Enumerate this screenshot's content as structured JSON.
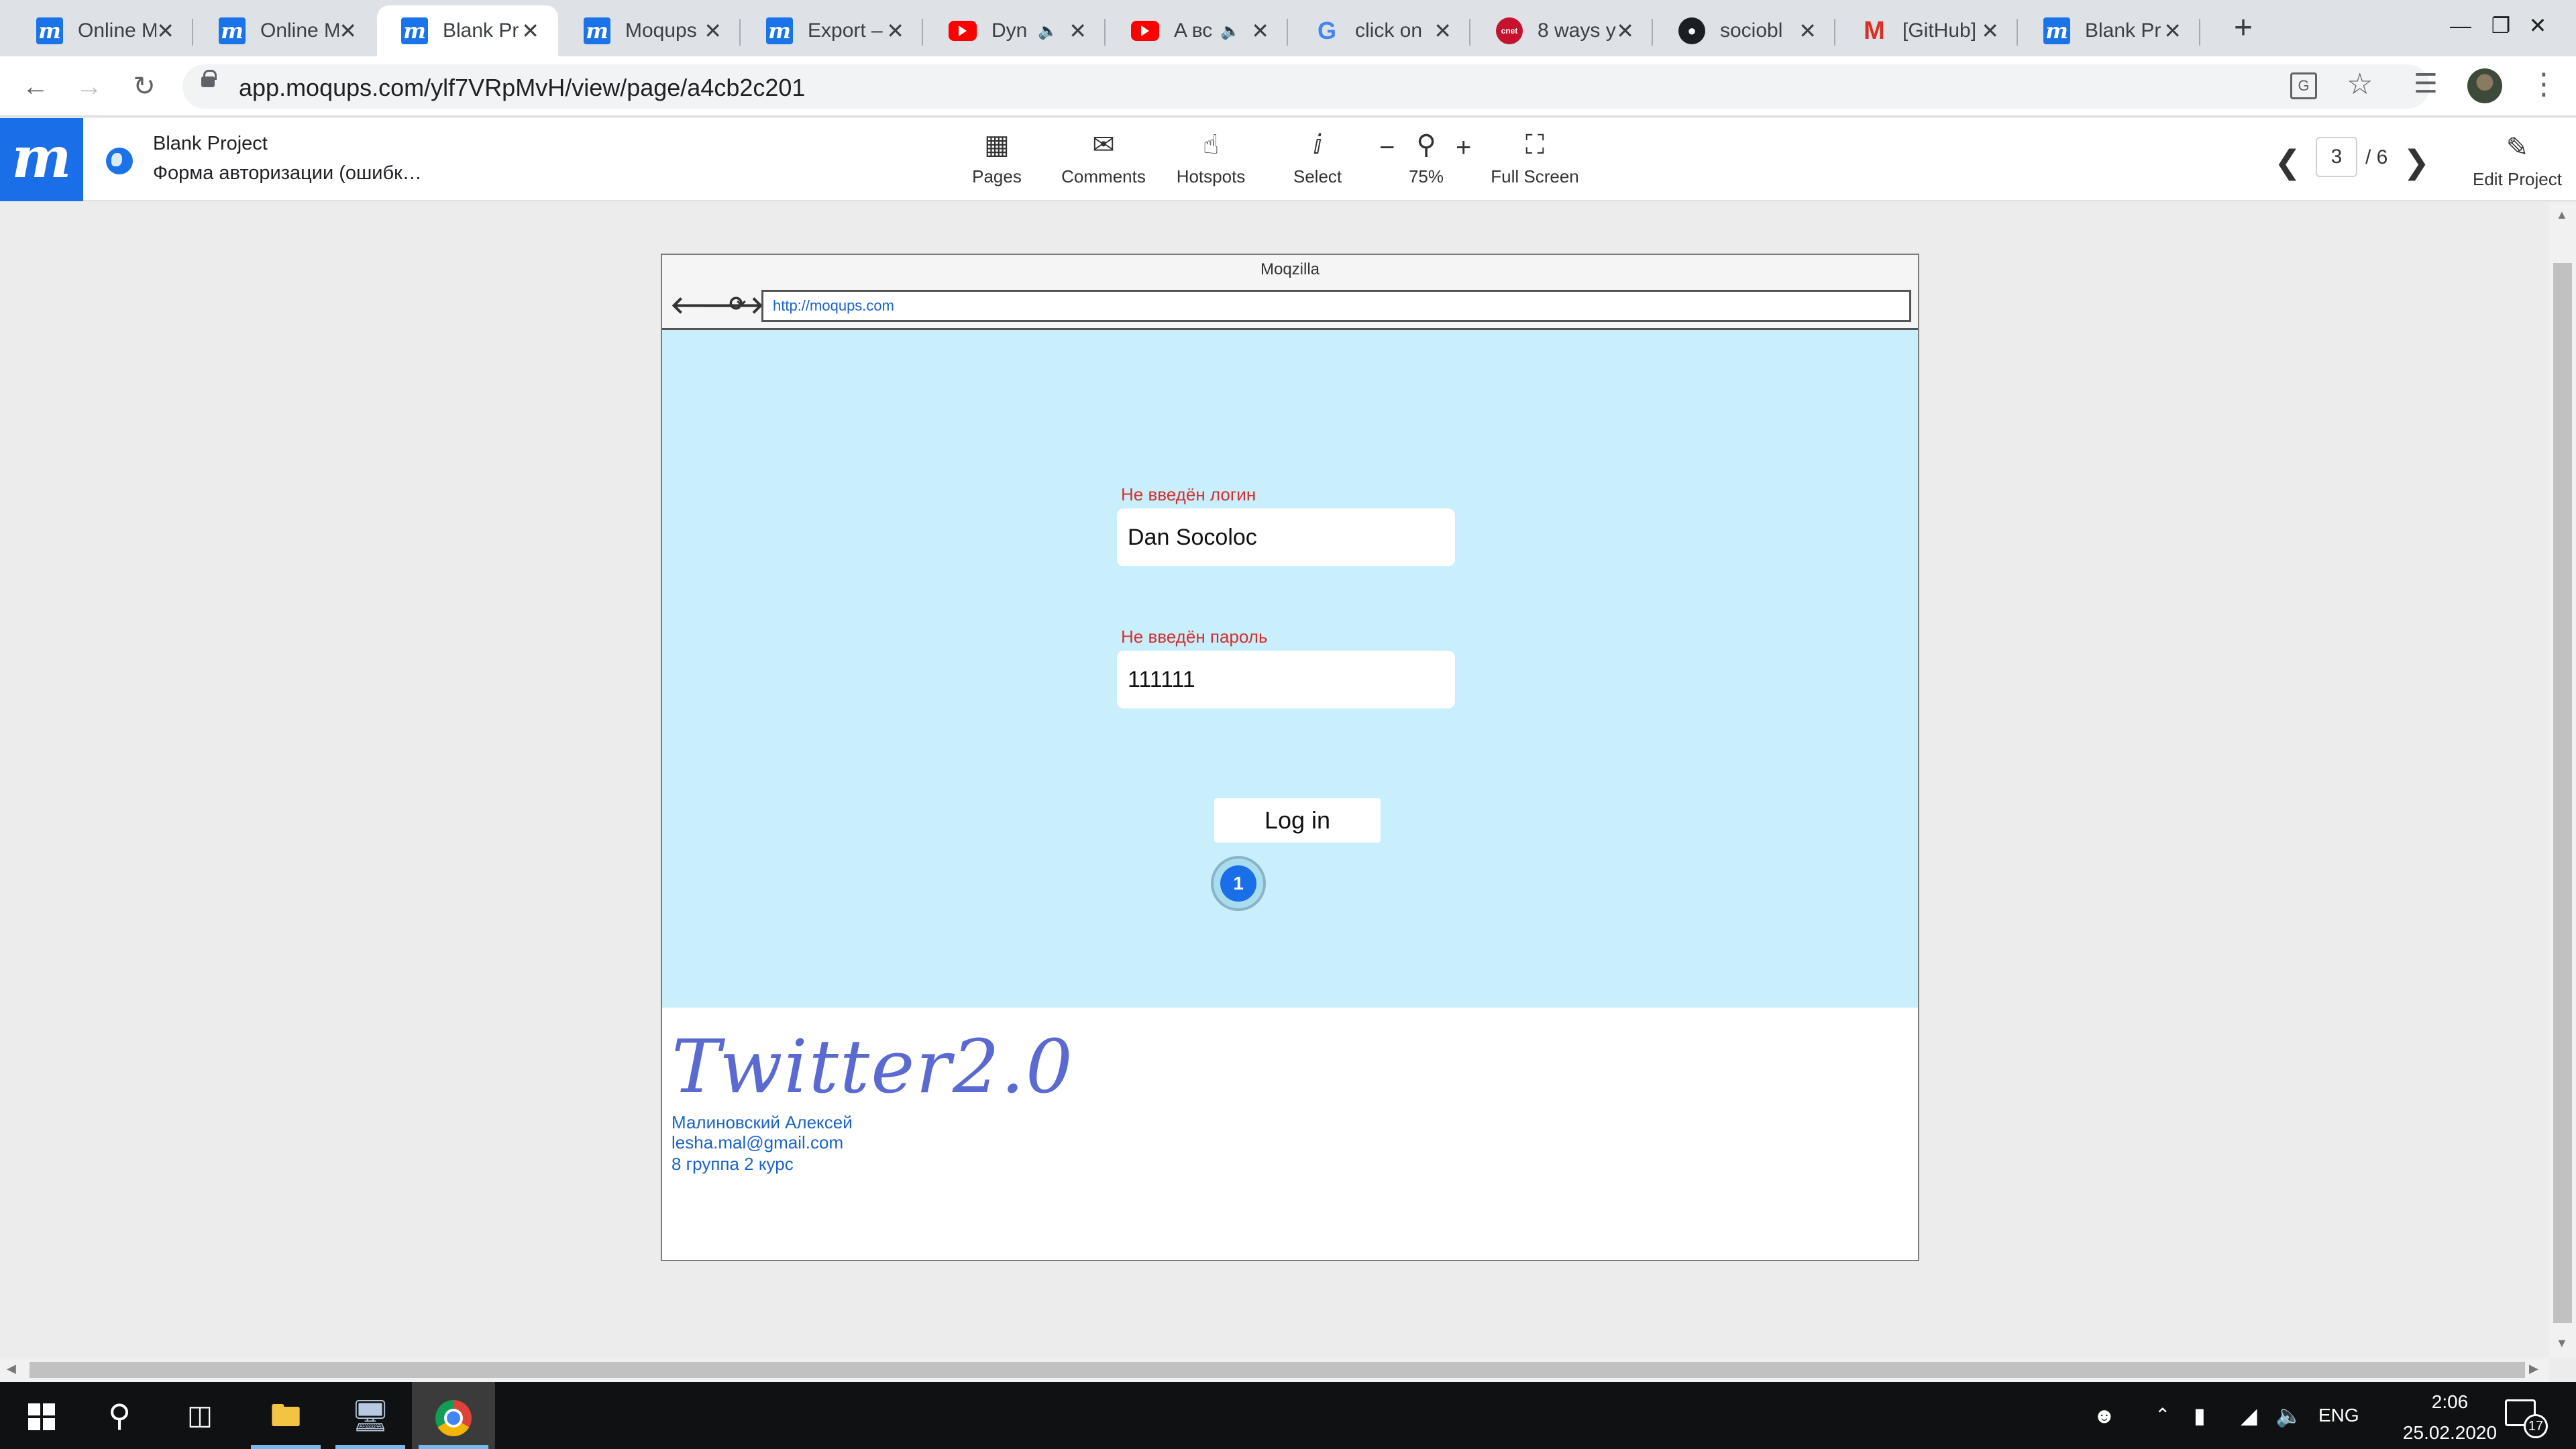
{
  "browser": {
    "tabs": [
      {
        "title": "Online M",
        "favicon": "moqups-icon",
        "active": false,
        "audio": false
      },
      {
        "title": "Online M",
        "favicon": "moqups-icon",
        "active": false,
        "audio": false
      },
      {
        "title": "Blank Pr",
        "favicon": "moqups-icon",
        "active": true,
        "audio": false
      },
      {
        "title": "Moqups",
        "favicon": "moqups-icon",
        "active": false,
        "audio": false
      },
      {
        "title": "Export –",
        "favicon": "moqups-icon",
        "active": false,
        "audio": false
      },
      {
        "title": "Dyn",
        "favicon": "youtube-icon",
        "active": false,
        "audio": true
      },
      {
        "title": "A вс",
        "favicon": "youtube-icon",
        "active": false,
        "audio": true
      },
      {
        "title": "click on",
        "favicon": "google-icon",
        "active": false,
        "audio": false
      },
      {
        "title": "8 ways y",
        "favicon": "cnet-icon",
        "active": false,
        "audio": false
      },
      {
        "title": "sociobl",
        "favicon": "github-icon",
        "active": false,
        "audio": false
      },
      {
        "title": "[GitHub]",
        "favicon": "gmail-icon",
        "active": false,
        "audio": false
      },
      {
        "title": "Blank Pr",
        "favicon": "moqups-icon",
        "active": false,
        "audio": false
      }
    ],
    "url": "app.moqups.com/ylf7VRpMvH/view/page/a4cb2c201"
  },
  "moqups": {
    "project_name": "Blank Project",
    "page_name": "Форма авторизации (ошибк…",
    "tools": {
      "pages": "Pages",
      "comments": "Comments",
      "hotspots": "Hotspots",
      "select": "Select",
      "zoom": "75%",
      "zoom_out": "−",
      "zoom_in": "+",
      "fullscreen": "Full Screen"
    },
    "pagination": {
      "current": "3",
      "total": "/ 6"
    },
    "edit_label": "Edit Project"
  },
  "mockup": {
    "window_title": "Moqzilla",
    "url": "http://moqups.com",
    "login_error": "Не введён логин",
    "login_value": "Dan Socoloc",
    "password_error": "Не введён пароль",
    "password_value": "111111",
    "login_button": "Log in",
    "hotspot_number": "1",
    "brand": "Twitter2.0",
    "footer_lines": [
      "Малиновский Алексей",
      "lesha.mal@gmail.com",
      "8 группа 2 курс"
    ]
  },
  "taskbar": {
    "language": "ENG",
    "time": "2:06",
    "date": "25.02.2020",
    "notifications": "17"
  },
  "colors": {
    "moqups_brand": "#1a6fe8",
    "mock_background": "#c9eefc",
    "error_text": "#d32f2f",
    "link_text": "#1a63c7"
  }
}
